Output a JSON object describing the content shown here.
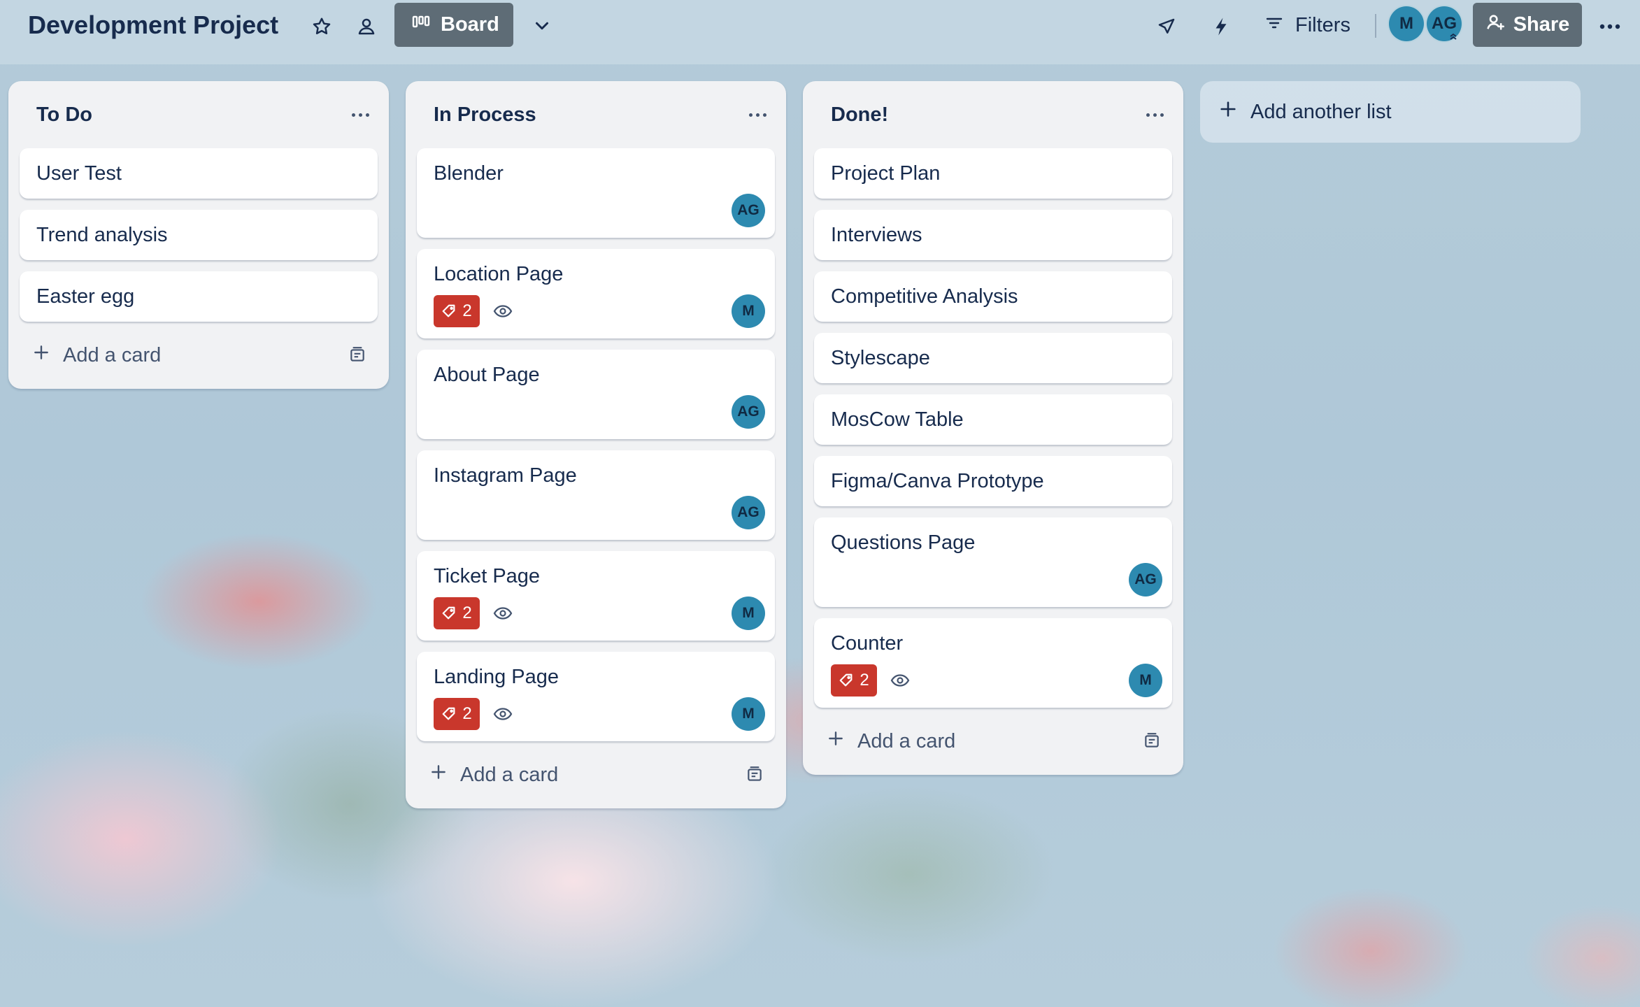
{
  "header": {
    "board_title": "Development Project",
    "star_icon": "star-icon",
    "workspace_visibility_icon": "people-icon",
    "view_label": "Board",
    "view_icon": "board-icon",
    "filters_label": "Filters",
    "share_label": "Share",
    "members": [
      "M",
      "AG"
    ],
    "accent_color": "#5e6c76"
  },
  "lists": [
    {
      "title": "To Do",
      "cards": [
        {
          "title": "User Test"
        },
        {
          "title": "Trend analysis"
        },
        {
          "title": "Easter egg"
        }
      ],
      "add_card_label": "Add a card"
    },
    {
      "title": "In Process",
      "cards": [
        {
          "title": "Blender",
          "member": "AG"
        },
        {
          "title": "Location Page",
          "badge": "2",
          "watching": true,
          "member": "M"
        },
        {
          "title": "About Page",
          "member": "AG"
        },
        {
          "title": "Instagram Page",
          "member": "AG"
        },
        {
          "title": "Ticket Page",
          "badge": "2",
          "watching": true,
          "member": "M"
        },
        {
          "title": "Landing Page",
          "badge": "2",
          "watching": true,
          "member": "M"
        }
      ],
      "add_card_label": "Add a card"
    },
    {
      "title": "Done!",
      "cards": [
        {
          "title": "Project Plan"
        },
        {
          "title": "Interviews"
        },
        {
          "title": "Competitive Analysis"
        },
        {
          "title": "Stylescape"
        },
        {
          "title": "MosCow Table"
        },
        {
          "title": "Figma/Canva Prototype"
        },
        {
          "title": "Questions Page",
          "member": "AG"
        },
        {
          "title": "Counter",
          "badge": "2",
          "watching": true,
          "member": "M"
        }
      ],
      "add_card_label": "Add a card"
    }
  ],
  "add_list_label": "Add another list",
  "colors": {
    "badge_red": "#c9372c",
    "avatar_teal": "#2d8ab0",
    "list_bg": "#f1f2f4"
  }
}
